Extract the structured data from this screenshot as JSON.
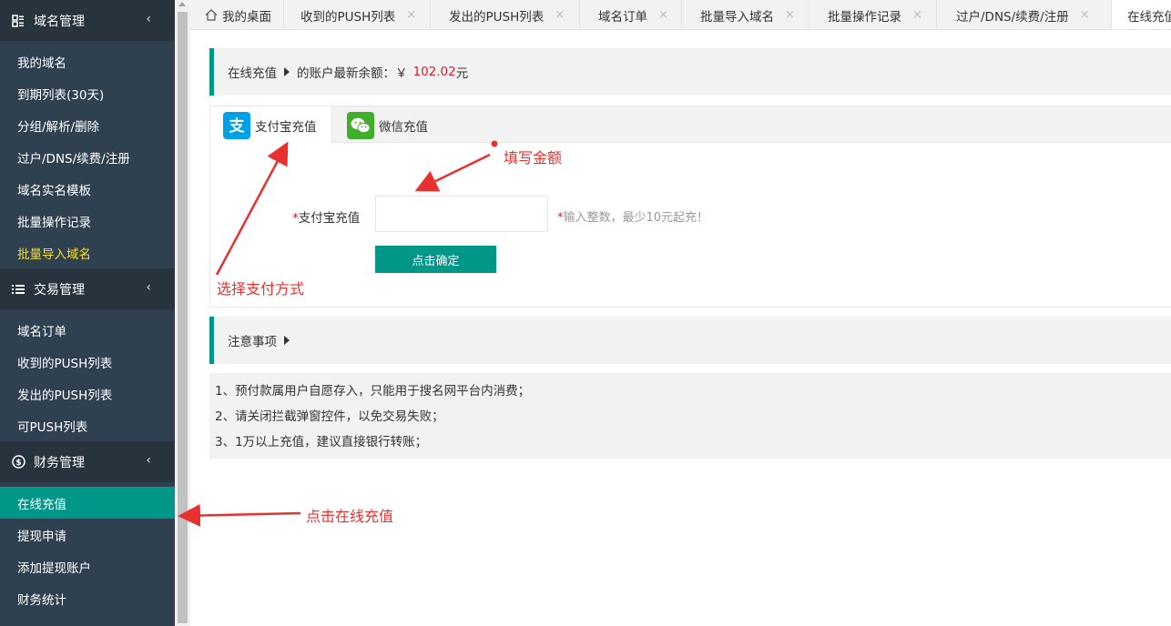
{
  "sidebar": {
    "sections": [
      {
        "title": "域名管理",
        "icon": "grid-icon",
        "items": [
          {
            "label": "我的域名"
          },
          {
            "label": "到期列表(30天)"
          },
          {
            "label": "分组/解析/删除"
          },
          {
            "label": "过户/DNS/续费/注册"
          },
          {
            "label": "域名实名模板"
          },
          {
            "label": "批量操作记录"
          },
          {
            "label": "批量导入域名",
            "state": "highlighted"
          }
        ]
      },
      {
        "title": "交易管理",
        "icon": "list-icon",
        "items": [
          {
            "label": "域名订单"
          },
          {
            "label": "收到的PUSH列表"
          },
          {
            "label": "发出的PUSH列表"
          },
          {
            "label": "可PUSH列表"
          }
        ]
      },
      {
        "title": "财务管理",
        "icon": "dollar-icon",
        "items": [
          {
            "label": "在线充值",
            "state": "active"
          },
          {
            "label": "提现申请"
          },
          {
            "label": "添加提现账户"
          },
          {
            "label": "财务统计"
          }
        ]
      }
    ],
    "chevron": "‹"
  },
  "tabs": [
    {
      "label": "我的桌面",
      "icon": "home-icon"
    },
    {
      "label": "收到的PUSH列表",
      "close": "×"
    },
    {
      "label": "发出的PUSH列表",
      "close": "×"
    },
    {
      "label": "域名订单",
      "close": "×"
    },
    {
      "label": "批量导入域名",
      "close": "×"
    },
    {
      "label": "批量操作记录",
      "close": "×"
    },
    {
      "label": "过户/DNS/续费/注册",
      "close": "×"
    },
    {
      "label": "在线充值",
      "state": "active"
    }
  ],
  "header": {
    "crumb": "在线充值",
    "balance_prefix": "的账户最新余额：￥",
    "balance_value": "102.02",
    "balance_unit": "元"
  },
  "payment": {
    "tabs": [
      {
        "label": "支付宝充值",
        "icon": "alipay-icon",
        "state": "active"
      },
      {
        "label": "微信充值",
        "icon": "wechat-icon"
      }
    ],
    "field": {
      "required_mark": "*",
      "label": "支付宝充值",
      "value": "",
      "placeholder": "",
      "tip_mark": "*",
      "tip": "输入整数，最少10元起充！"
    },
    "submit_label": "点击确定"
  },
  "notes": {
    "title": "注意事项",
    "lines": [
      "1、预付款属用户自愿存入，只能用于搜名网平台内消费；",
      "2、请关闭拦截弹窗控件，以免交易失败；",
      "3、1万以上充值，建议直接银行转账；"
    ]
  },
  "annotations": {
    "fill_amount": "填写金额",
    "choose_payment": "选择支付方式",
    "click_recharge": "点击在线充值",
    "color": "#e8312f"
  },
  "colors": {
    "sidebar_bg": "#2f4050",
    "section_bg": "#28333e",
    "accent": "#009688",
    "highlight_text": "#f5dd32",
    "balance": "#e0182c"
  }
}
